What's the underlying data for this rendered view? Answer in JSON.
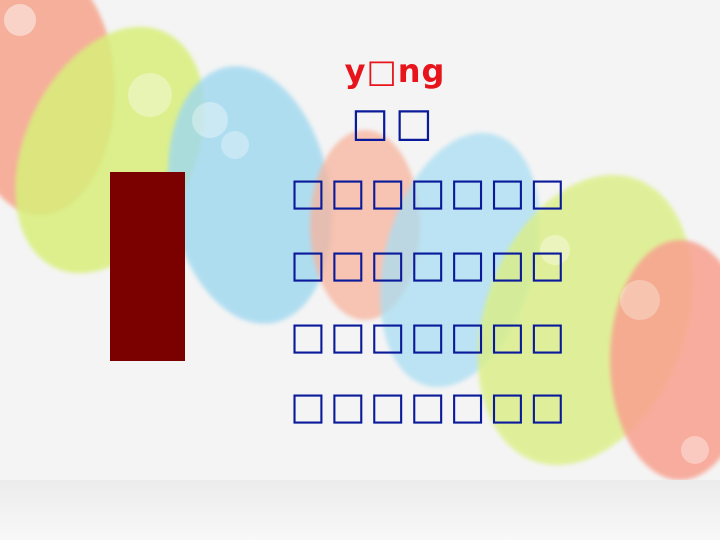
{
  "slide": {
    "pinyin": "y□ng",
    "title": "□□",
    "poem_lines": [
      "□□□□□□□",
      "□□□□□□□",
      "□□□□□□□",
      "□□□□□□□"
    ]
  },
  "colors": {
    "title_block": "#7b0000",
    "pinyin": "#e8141c",
    "text": "#0a1a9a"
  }
}
